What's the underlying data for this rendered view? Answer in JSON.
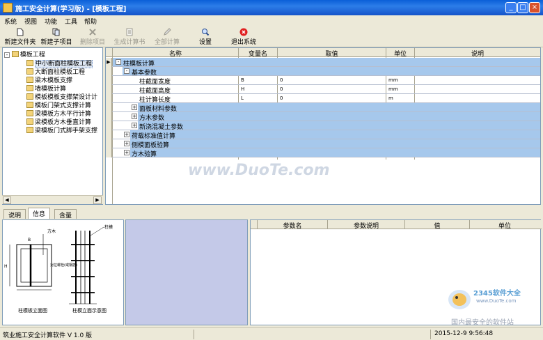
{
  "window": {
    "title": "施工安全计算(学习版) - [模板工程]"
  },
  "menu": [
    "系统",
    "视图",
    "功能",
    "工具",
    "帮助"
  ],
  "toolbar": {
    "new_folder": "新建文件夹",
    "new_subitem": "新建子项目",
    "delete_item": "删除项目",
    "gen_book": "生成计算书",
    "calc_all": "全部计算",
    "settings": "设置",
    "exit": "退出系统"
  },
  "tree": {
    "root": "模板工程",
    "items": [
      "中小断面柱模板工程",
      "大断面柱模板工程",
      "梁木模板支撑",
      "墙模板计算",
      "模板模板支撑架设计计",
      "模板门架式支撑计算",
      "梁模板方木平行计算",
      "梁模板方木垂直计算",
      "梁模板门式脚手架支撑"
    ]
  },
  "grid": {
    "headers": {
      "name": "名称",
      "var": "变量名",
      "value": "取值",
      "unit": "单位",
      "desc": "说明"
    },
    "rows": [
      {
        "name": "柱模板计算",
        "var": "",
        "value": "",
        "unit": "",
        "toggle": "-"
      },
      {
        "name": "基本参数",
        "var": "",
        "value": "",
        "unit": "",
        "toggle": "-"
      },
      {
        "name": "柱截面宽度",
        "var": "B",
        "value": "0",
        "unit": "mm",
        "toggle": ""
      },
      {
        "name": "柱截面高度",
        "var": "H",
        "value": "0",
        "unit": "mm",
        "toggle": ""
      },
      {
        "name": "柱计算长度",
        "var": "L",
        "value": "0",
        "unit": "m",
        "toggle": ""
      },
      {
        "name": "面板材料参数",
        "var": "",
        "value": "",
        "unit": "",
        "toggle": "+"
      },
      {
        "name": "方木参数",
        "var": "",
        "value": "",
        "unit": "",
        "toggle": "+"
      },
      {
        "name": "新浇混凝土参数",
        "var": "",
        "value": "",
        "unit": "",
        "toggle": "+"
      },
      {
        "name": "荷载标准值计算",
        "var": "",
        "value": "",
        "unit": "",
        "toggle": "+"
      },
      {
        "name": "侧模面板验算",
        "var": "",
        "value": "",
        "unit": "",
        "toggle": "+"
      },
      {
        "name": "方木验算",
        "var": "",
        "value": "",
        "unit": "",
        "toggle": "+"
      }
    ],
    "current_row_marker": "▶"
  },
  "watermark": "www.DuoTe.com",
  "tabs": [
    "说明",
    "信息",
    "含量"
  ],
  "diagram": {
    "label_left": "柱模板立面图",
    "label_right": "柱模立面示意图",
    "annotations": [
      "方木",
      "B",
      "H",
      "柱模",
      "对拉螺栓(或钢筋)"
    ]
  },
  "param_grid": {
    "headers": [
      "参数名",
      "参数说明",
      "值",
      "单位"
    ]
  },
  "status": {
    "app": "筑业施工安全计算软件 V 1.0 版",
    "datetime": "2015-12-9 9:56:48"
  },
  "badge": {
    "brand": "2345软件大全",
    "site": "www.DuoTe.com",
    "slogan": "国内最安全的软件站"
  }
}
